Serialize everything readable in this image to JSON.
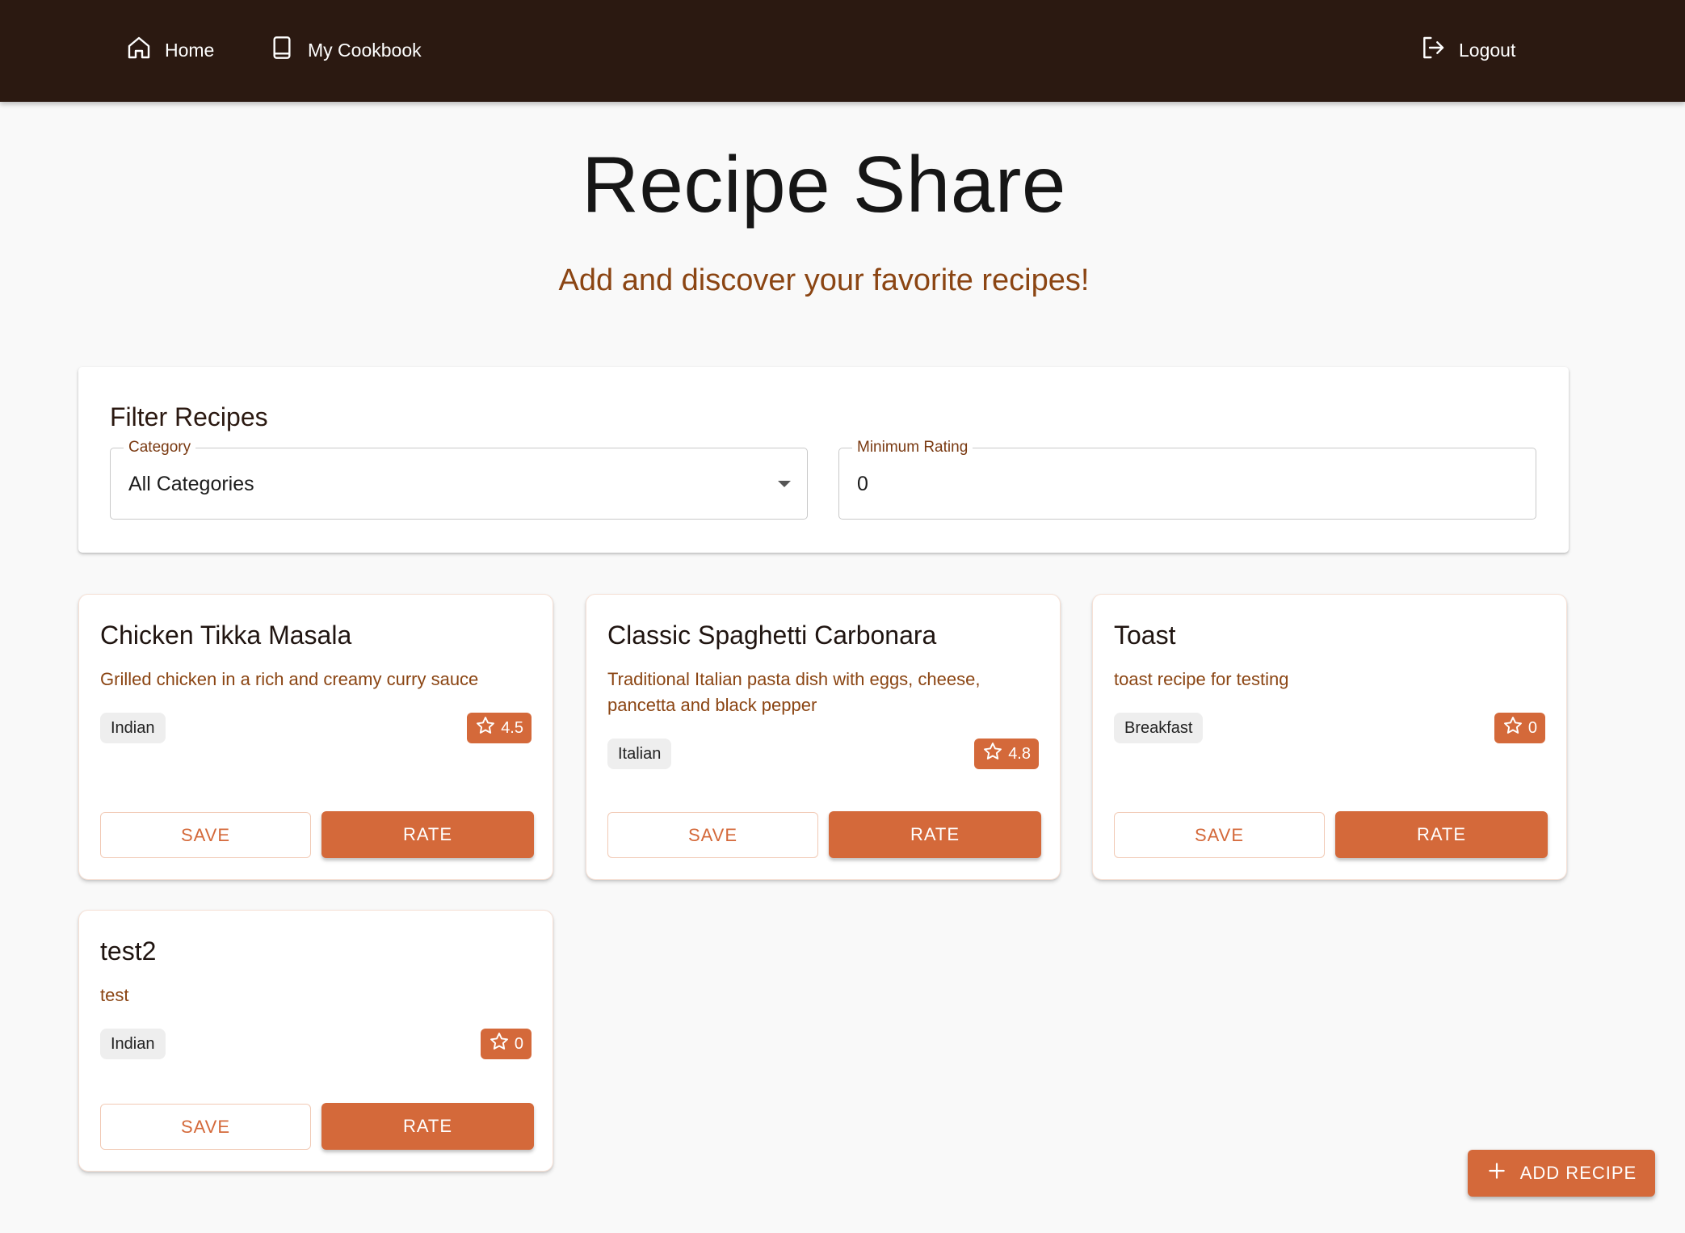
{
  "nav": {
    "home_label": "Home",
    "cookbook_label": "My Cookbook",
    "logout_label": "Logout"
  },
  "header": {
    "title": "Recipe Share",
    "subtitle": "Add and discover your favorite recipes!"
  },
  "filters": {
    "title": "Filter Recipes",
    "category_label": "Category",
    "category_value": "All Categories",
    "rating_label": "Minimum Rating",
    "rating_value": "0"
  },
  "recipes": [
    {
      "title": "Chicken Tikka Masala",
      "description": "Grilled chicken in a rich and creamy curry sauce",
      "category": "Indian",
      "rating": "4.5",
      "save_label": "SAVE",
      "rate_label": "RATE"
    },
    {
      "title": "Classic Spaghetti Carbonara",
      "description": "Traditional Italian pasta dish with eggs, cheese, pancetta and black pepper",
      "category": "Italian",
      "rating": "4.8",
      "save_label": "SAVE",
      "rate_label": "RATE"
    },
    {
      "title": "Toast",
      "description": "toast recipe for testing",
      "category": "Breakfast",
      "rating": "0",
      "save_label": "SAVE",
      "rate_label": "RATE"
    },
    {
      "title": "test2",
      "description": "test",
      "category": "Indian",
      "rating": "0",
      "save_label": "SAVE",
      "rate_label": "RATE"
    }
  ],
  "fab": {
    "label": "ADD RECIPE"
  },
  "icons": {
    "home": "home-icon",
    "cookbook": "book-icon",
    "logout": "logout-icon",
    "star": "star-icon",
    "plus": "plus-icon",
    "dropdown": "chevron-down-icon"
  },
  "colors": {
    "topbar": "#2b1911",
    "accent": "#d4693a",
    "subtitle": "#8b4513"
  }
}
